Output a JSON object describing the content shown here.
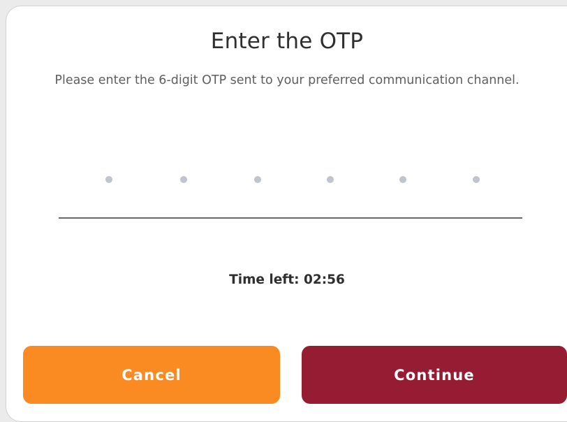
{
  "dialog": {
    "title": "Enter the OTP",
    "subtitle": "Please enter the 6-digit OTP sent to your preferred communication channel.",
    "otp": {
      "length": 6,
      "filled_digits": 0,
      "placeholder_dot_color": "#bfc4cd"
    },
    "timer": {
      "label": "Time left:",
      "value": "02:56"
    },
    "buttons": {
      "cancel_label": "Cancel",
      "continue_label": "Continue"
    },
    "colors": {
      "cancel": "#fa8a22",
      "continue": "#951c32"
    }
  }
}
